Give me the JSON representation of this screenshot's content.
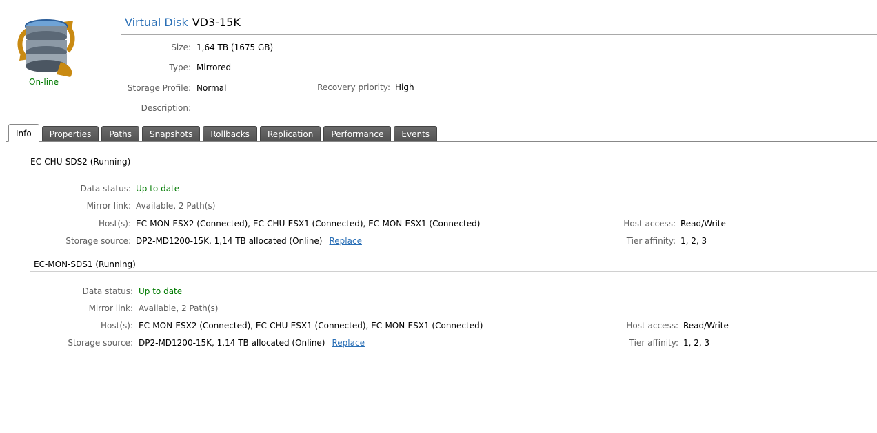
{
  "header": {
    "kind": "Virtual Disk",
    "name": "VD3-15K",
    "state": "On-line",
    "fields": {
      "size_label": "Size:",
      "size_value": "1,64 TB (1675 GB)",
      "type_label": "Type:",
      "type_value": "Mirrored",
      "profile_label": "Storage Profile:",
      "profile_value": "Normal",
      "recovery_label": "Recovery priority:",
      "recovery_value": "High",
      "description_label": "Description:",
      "description_value": ""
    }
  },
  "tabs": [
    "Info",
    "Properties",
    "Paths",
    "Snapshots",
    "Rollbacks",
    "Replication",
    "Performance",
    "Events"
  ],
  "active_tab": "Info",
  "sections": [
    {
      "title": "EC-CHU-SDS2 (Running)",
      "data_status_label": "Data status:",
      "data_status": "Up to date",
      "mirror_link_label": "Mirror link:",
      "mirror_link": "Available, 2 Path(s)",
      "hosts_label": "Host(s):",
      "hosts": "EC-MON-ESX2 (Connected), EC-CHU-ESX1 (Connected), EC-MON-ESX1 (Connected)",
      "storage_source_label": "Storage source:",
      "storage_source": "DP2-MD1200-15K, 1,14 TB allocated (Online)",
      "replace_link": "Replace",
      "host_access_label": "Host access:",
      "host_access": "Read/Write",
      "tier_affinity_label": "Tier affinity:",
      "tier_affinity": "1, 2, 3"
    },
    {
      "title": "EC-MON-SDS1 (Running)",
      "data_status_label": "Data status:",
      "data_status": "Up to date",
      "mirror_link_label": "Mirror link:",
      "mirror_link": "Available, 2 Path(s)",
      "hosts_label": "Host(s):",
      "hosts": "EC-MON-ESX2 (Connected), EC-CHU-ESX1 (Connected), EC-MON-ESX1 (Connected)",
      "storage_source_label": "Storage source:",
      "storage_source": "DP2-MD1200-15K, 1,14 TB allocated (Online)",
      "replace_link": "Replace",
      "host_access_label": "Host access:",
      "host_access": "Read/Write",
      "tier_affinity_label": "Tier affinity:",
      "tier_affinity": "1, 2, 3"
    }
  ],
  "colors": {
    "status_green": "#007a00",
    "title_blue": "#2a6fb6",
    "tab_dark": "#5a5a5a"
  }
}
